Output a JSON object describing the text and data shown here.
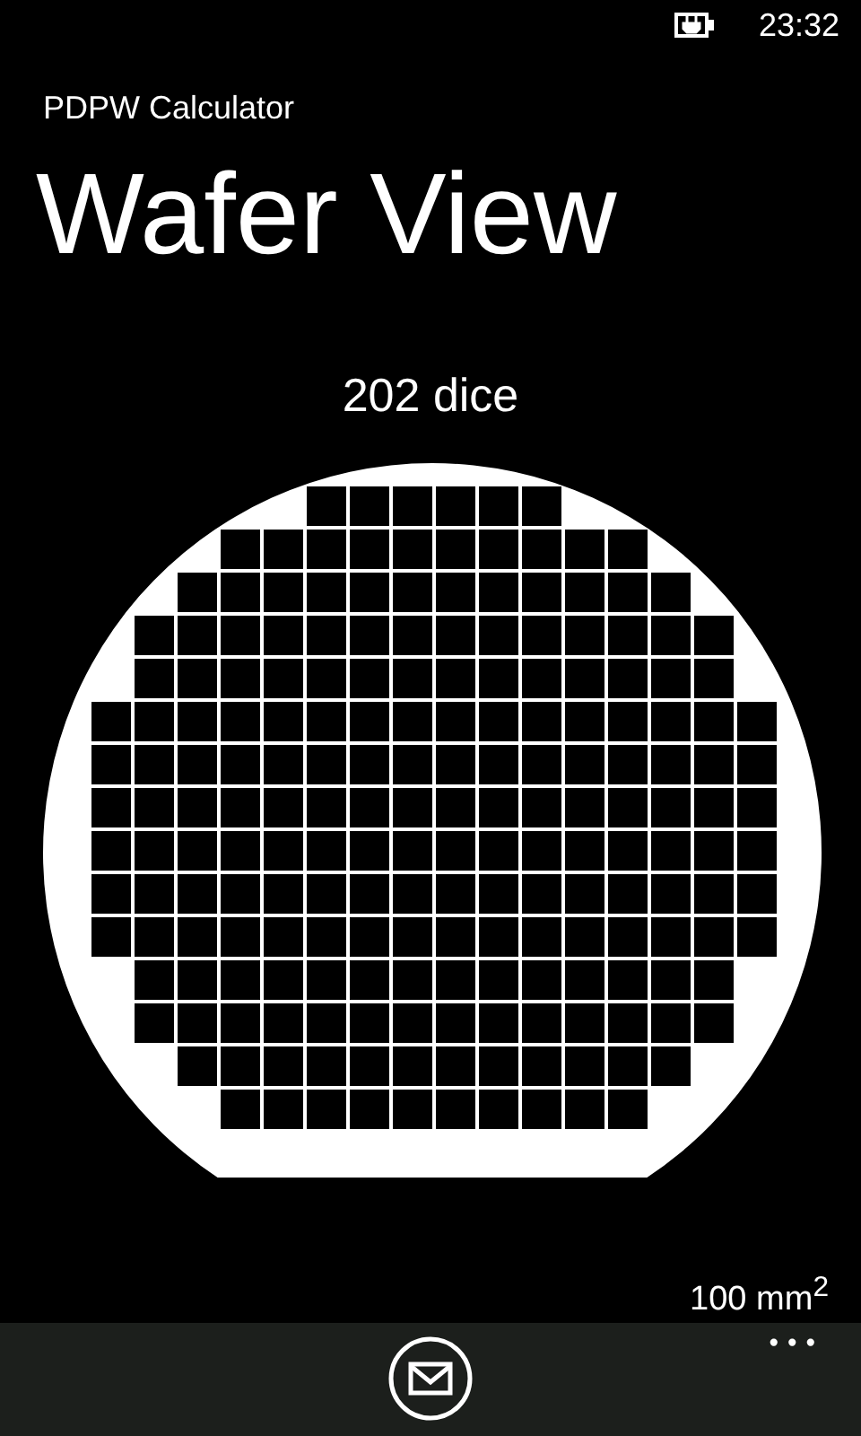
{
  "status_bar": {
    "time": "23:32",
    "charging": true
  },
  "app_title": "PDPW Calculator",
  "page_title": "Wafer View",
  "die_count": "202 dice",
  "die_area": "100 mm$^{2}$",
  "app_bar": {
    "buttons": [
      {
        "kind": "mail"
      }
    ],
    "more": "•••"
  }
}
